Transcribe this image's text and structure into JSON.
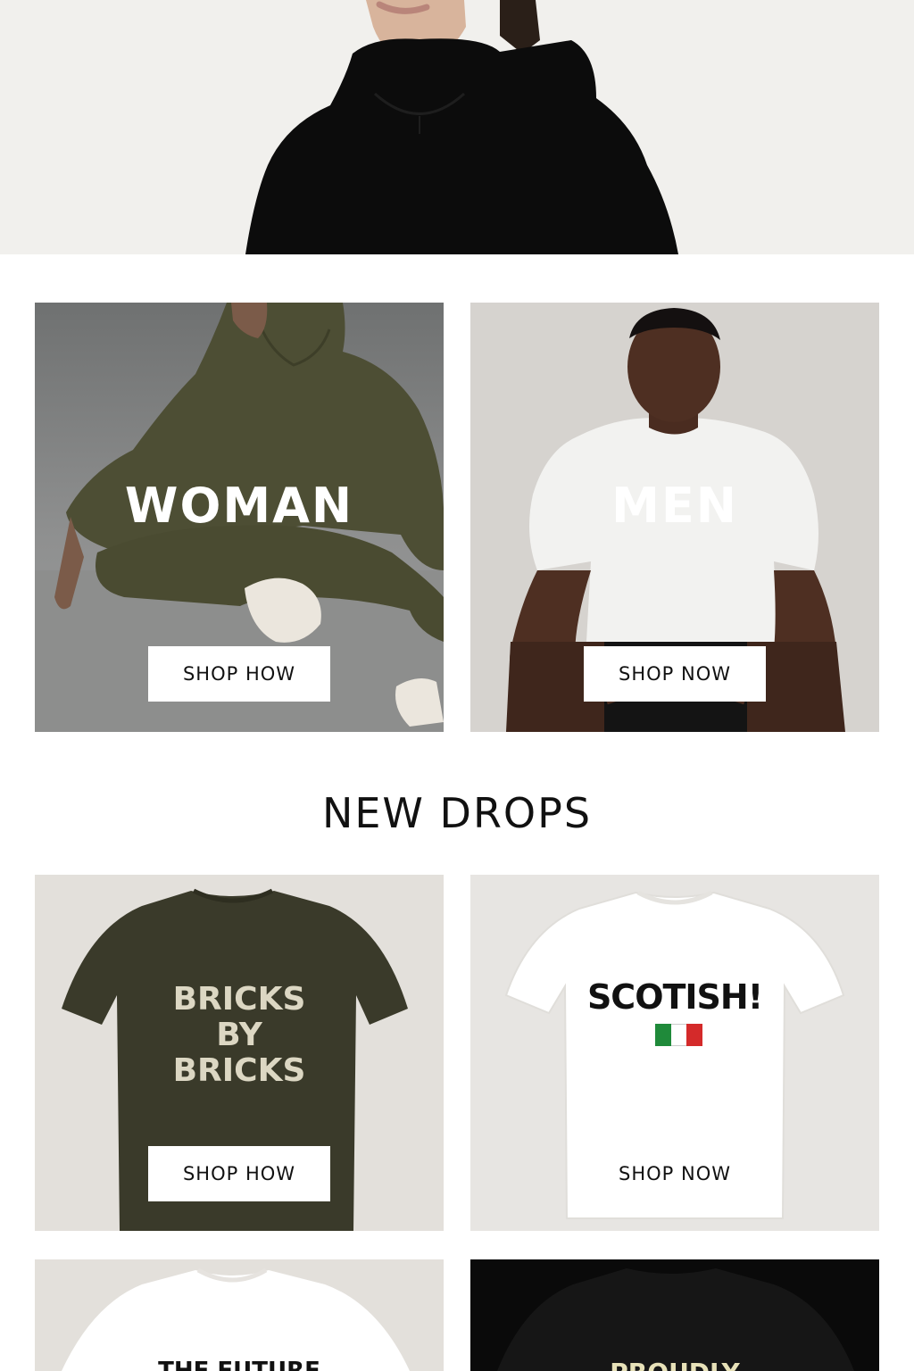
{
  "hero": {
    "alt_icon": "model-black-hoodie"
  },
  "categories": [
    {
      "title": "WOMAN",
      "button": "SHOP HOW"
    },
    {
      "title": "MEN",
      "button": "SHOP NOW"
    }
  ],
  "new_drops": {
    "heading": "NEW DROPS",
    "products": [
      {
        "print": [
          "BRICKS",
          "BY",
          "BRICKS"
        ],
        "button": "SHOP HOW",
        "shirt_color": "#3a3a2a"
      },
      {
        "print": [
          "SCOTISH!"
        ],
        "button": "SHOP NOW",
        "shirt_color": "#ffffff",
        "flag": [
          "#1f8a3a",
          "#ffffff",
          "#d42a2a"
        ]
      },
      {
        "print": [
          "THE FUTURE"
        ],
        "shirt_color": "#ffffff"
      },
      {
        "print": [
          "PROUDLY"
        ],
        "shirt_color": "#111111"
      }
    ]
  },
  "colors": {
    "background": "#ffffff",
    "button_bg": "#ffffff",
    "button_text": "#111111"
  }
}
